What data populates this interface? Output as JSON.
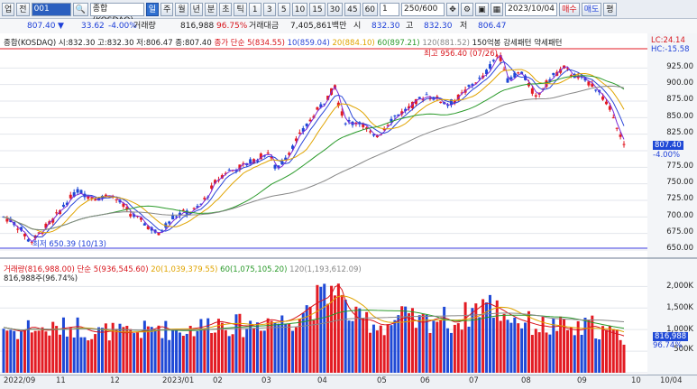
{
  "toolbar": {
    "menu_label": "업",
    "view_label": "전",
    "code": "001",
    "name": "종합(KOSDAQ)",
    "period_buttons": [
      "일",
      "주",
      "월",
      "년",
      "분",
      "초",
      "틱"
    ],
    "minute_buttons": [
      "1",
      "3",
      "5",
      "10",
      "15",
      "30",
      "45",
      "60"
    ],
    "interval_value": "1",
    "count_value": "250/600",
    "date_value": "2023/10/04",
    "buy_label": "매수",
    "sell_label": "매도",
    "eval_label": "평"
  },
  "pricebar": {
    "price": "807.40",
    "change": "33.62",
    "change_pct": "-4.00%",
    "volume_label": "거래량",
    "volume_value": "816,988",
    "volume_ratio": "96.75%",
    "amount_label": "거래대금",
    "amount_value": "7,405,861백만",
    "open_label": "시",
    "open_value": "832.30",
    "high_label": "고",
    "high_value": "832.30",
    "low_label": "저",
    "low_value": "806.47"
  },
  "price_panel": {
    "legend_main": "종합(KOSDAQ) 시:832.30 고:832.30 저:806.47 종:807.40",
    "legend_ma5": "종가 단순 5(834.55)",
    "legend_ma10": "10(859.04)",
    "legend_ma20": "20(884.10)",
    "legend_ma60": "60(897.21)",
    "legend_ma120": "120(881.52)",
    "legend_ma150": "150억봉 강세패턴 약세패턴",
    "lc_label": "LC:24.14",
    "hc_label": "HC:-15.58",
    "high_note": "최고 956.40 (07/26)",
    "low_note": "최저 650.39 (10/13)",
    "last_price": "807.40",
    "last_pct": "-4.00%",
    "yticks": [
      "925.00",
      "900.00",
      "875.00",
      "850.00",
      "825.00",
      "800.00",
      "775.00",
      "750.00",
      "725.00",
      "700.00",
      "675.00",
      "650.00"
    ]
  },
  "volume_panel": {
    "legend_vol": "거래량(816,988.00)",
    "legend_ma5": "단순 5(936,545.60)",
    "legend_ma20": "20(1,039,379.55)",
    "legend_ma60": "60(1,075,105.20)",
    "legend_ma120": "120(1,193,612.09)",
    "sub_legend": "816,988주(96.74%)",
    "yticks": [
      "2,000K",
      "1,500K",
      "1,000K",
      "500K"
    ],
    "last_vol": "816,988",
    "last_pct": "96.74%"
  },
  "xaxis": {
    "labels": [
      "2022/09",
      "11",
      "12",
      "2023/01",
      "02",
      "03",
      "04",
      "05",
      "06",
      "07",
      "08",
      "09",
      "10"
    ],
    "right_label": "10/04"
  },
  "chart_data": {
    "type": "candlestick",
    "price_axis": {
      "min": 650,
      "max": 950
    },
    "volume_axis": {
      "min": 0,
      "max": 2300000
    },
    "highest": {
      "value": 956.4,
      "date": "07/26"
    },
    "lowest": {
      "value": 650.39,
      "date": "10/13"
    },
    "close_series": [
      [
        0,
        700
      ],
      [
        5,
        693
      ],
      [
        10,
        680
      ],
      [
        15,
        662
      ],
      [
        18,
        668
      ],
      [
        22,
        680
      ],
      [
        28,
        695
      ],
      [
        35,
        720
      ],
      [
        42,
        740
      ],
      [
        48,
        732
      ],
      [
        55,
        728
      ],
      [
        60,
        735
      ],
      [
        66,
        722
      ],
      [
        72,
        705
      ],
      [
        76,
        698
      ],
      [
        80,
        690
      ],
      [
        85,
        680
      ],
      [
        88,
        672
      ],
      [
        92,
        688
      ],
      [
        96,
        700
      ],
      [
        100,
        705
      ],
      [
        105,
        708
      ],
      [
        110,
        712
      ],
      [
        115,
        730
      ],
      [
        120,
        752
      ],
      [
        126,
        768
      ],
      [
        132,
        773
      ],
      [
        138,
        780
      ],
      [
        144,
        788
      ],
      [
        150,
        798
      ],
      [
        155,
        770
      ],
      [
        160,
        790
      ],
      [
        165,
        812
      ],
      [
        170,
        830
      ],
      [
        175,
        850
      ],
      [
        180,
        868
      ],
      [
        185,
        885
      ],
      [
        188,
        898
      ],
      [
        191,
        860
      ],
      [
        194,
        845
      ],
      [
        198,
        842
      ],
      [
        202,
        845
      ],
      [
        206,
        832
      ],
      [
        210,
        820
      ],
      [
        214,
        828
      ],
      [
        218,
        842
      ],
      [
        222,
        852
      ],
      [
        226,
        858
      ],
      [
        230,
        865
      ],
      [
        235,
        875
      ],
      [
        240,
        885
      ],
      [
        244,
        880
      ],
      [
        248,
        876
      ],
      [
        252,
        870
      ],
      [
        256,
        876
      ],
      [
        260,
        885
      ],
      [
        264,
        895
      ],
      [
        268,
        905
      ],
      [
        272,
        910
      ],
      [
        276,
        928
      ],
      [
        280,
        944
      ],
      [
        283,
        938
      ],
      [
        286,
        905
      ],
      [
        290,
        915
      ],
      [
        294,
        918
      ],
      [
        298,
        900
      ],
      [
        302,
        880
      ],
      [
        306,
        895
      ],
      [
        310,
        908
      ],
      [
        314,
        918
      ],
      [
        318,
        925
      ],
      [
        322,
        917
      ],
      [
        326,
        910
      ],
      [
        330,
        906
      ],
      [
        334,
        900
      ],
      [
        338,
        890
      ],
      [
        342,
        870
      ],
      [
        346,
        855
      ],
      [
        349,
        830
      ],
      [
        352,
        807
      ]
    ],
    "volume_series": [
      [
        0,
        1050
      ],
      [
        5,
        980
      ],
      [
        10,
        950
      ],
      [
        15,
        1100
      ],
      [
        18,
        1020
      ],
      [
        22,
        980
      ],
      [
        28,
        1000
      ],
      [
        35,
        1050
      ],
      [
        42,
        1080
      ],
      [
        48,
        960
      ],
      [
        55,
        930
      ],
      [
        60,
        980
      ],
      [
        66,
        920
      ],
      [
        72,
        940
      ],
      [
        76,
        950
      ],
      [
        80,
        980
      ],
      [
        85,
        1020
      ],
      [
        88,
        1100
      ],
      [
        92,
        1000
      ],
      [
        96,
        980
      ],
      [
        100,
        990
      ],
      [
        105,
        1020
      ],
      [
        110,
        1050
      ],
      [
        115,
        1100
      ],
      [
        120,
        1200
      ],
      [
        126,
        1150
      ],
      [
        132,
        1100
      ],
      [
        138,
        1080
      ],
      [
        144,
        1150
      ],
      [
        150,
        1250
      ],
      [
        155,
        1180
      ],
      [
        160,
        1200
      ],
      [
        165,
        1300
      ],
      [
        170,
        1450
      ],
      [
        175,
        1600
      ],
      [
        180,
        1700
      ],
      [
        185,
        1800
      ],
      [
        188,
        2250
      ],
      [
        191,
        1700
      ],
      [
        194,
        1500
      ],
      [
        198,
        1300
      ],
      [
        202,
        1200
      ],
      [
        206,
        1250
      ],
      [
        210,
        1150
      ],
      [
        214,
        1100
      ],
      [
        218,
        1120
      ],
      [
        222,
        1200
      ],
      [
        226,
        1300
      ],
      [
        230,
        1250
      ],
      [
        235,
        1150
      ],
      [
        240,
        1200
      ],
      [
        244,
        1250
      ],
      [
        248,
        1300
      ],
      [
        252,
        1200
      ],
      [
        256,
        1150
      ],
      [
        260,
        1250
      ],
      [
        264,
        1400
      ],
      [
        268,
        1500
      ],
      [
        272,
        1650
      ],
      [
        276,
        1550
      ],
      [
        280,
        1500
      ],
      [
        283,
        1400
      ],
      [
        286,
        1350
      ],
      [
        290,
        1250
      ],
      [
        294,
        1200
      ],
      [
        298,
        1150
      ],
      [
        302,
        1100
      ],
      [
        306,
        1080
      ],
      [
        310,
        1050
      ],
      [
        314,
        1100
      ],
      [
        318,
        1020
      ],
      [
        322,
        1000
      ],
      [
        326,
        980
      ],
      [
        330,
        1050
      ],
      [
        334,
        1100
      ],
      [
        338,
        1000
      ],
      [
        342,
        950
      ],
      [
        346,
        900
      ],
      [
        349,
        880
      ],
      [
        352,
        817
      ]
    ],
    "ma_series": [
      {
        "name": "5",
        "color": "#7b2ad8"
      },
      {
        "name": "10",
        "color": "#2b46d8"
      },
      {
        "name": "20",
        "color": "#e0a400"
      },
      {
        "name": "60",
        "color": "#2a9a2a"
      },
      {
        "name": "120",
        "color": "#888888"
      }
    ],
    "colors": {
      "up": "#e31b23",
      "down": "#1f49d6",
      "bg": "#ffffff",
      "grid": "#e3e6ec",
      "axis_bg": "#f3f5f8",
      "baseline": "#3a3adf"
    }
  }
}
